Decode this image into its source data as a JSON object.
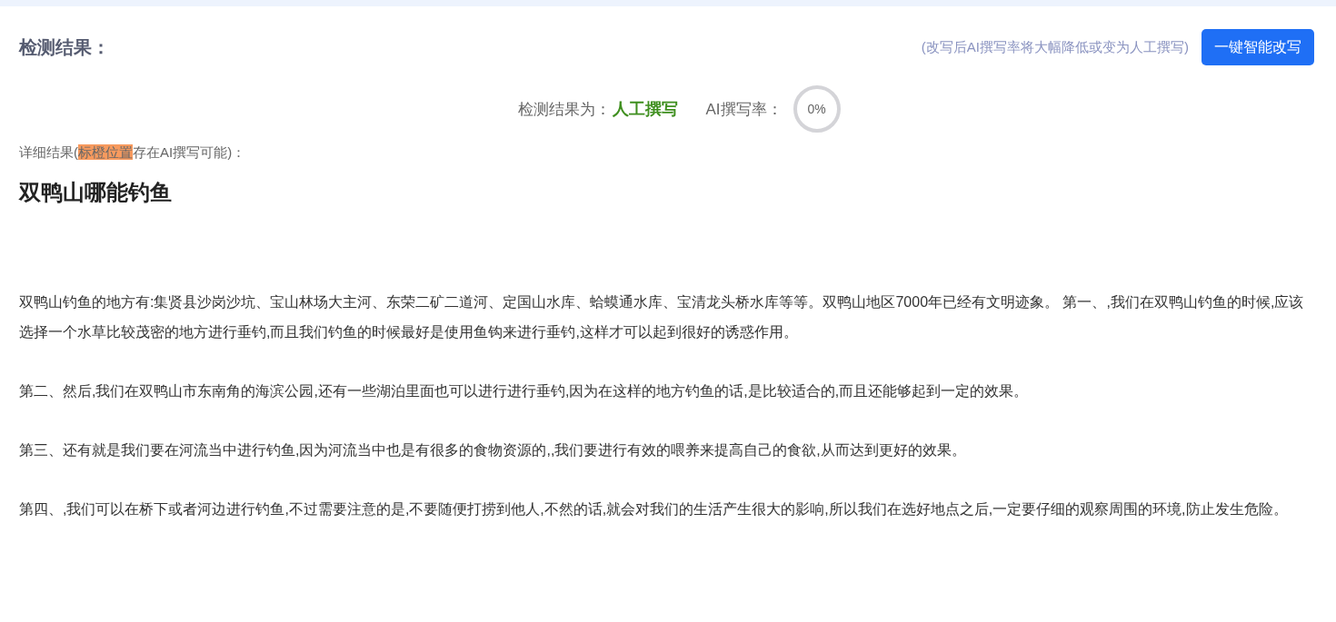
{
  "header": {
    "title": "检测结果：",
    "hint": "(改写后AI撰写率将大幅降低或变为人工撰写)",
    "rewrite_button": "一键智能改写"
  },
  "result": {
    "label": "检测结果为：",
    "verdict": {
      "text": "人工撰写",
      "kind": "human"
    },
    "rate_label": "AI撰写率：",
    "rate": {
      "text": "0%",
      "level": 0
    }
  },
  "detail": {
    "before": "详细结果(",
    "highlight": "标橙位置",
    "after": "存在AI撰写可能)："
  },
  "article": {
    "title": "双鸭山哪能钓鱼",
    "paragraphs": [
      {
        "text": "双鸭山钓鱼的地方有:集贤县沙岗沙坑、宝山林场大主河、东荣二矿二道河、定国山水库、蛤蟆通水库、宝清龙头桥水库等等。双鸭山地区7000年已经有文明迹象。 第一、,我们在双鸭山钓鱼的时候,应该选择一个水草比较茂密的地方进行垂钓,而且我们钓鱼的时候最好是使用鱼钩来进行垂钓,这样才可以起到很好的诱惑作用。"
      },
      {
        "text": "第二、然后,我们在双鸭山市东南角的海滨公园,还有一些湖泊里面也可以进行进行垂钓,因为在这样的地方钓鱼的话,是比较适合的,而且还能够起到一定的效果。"
      },
      {
        "text": "第三、还有就是我们要在河流当中进行钓鱼,因为河流当中也是有很多的食物资源的,,我们要进行有效的喂养来提高自己的食欲,从而达到更好的效果。"
      },
      {
        "text": "第四、,我们可以在桥下或者河边进行钓鱼,不过需要注意的是,不要随便打捞到他人,不然的话,就会对我们的生活产生很大的影响,所以我们在选好地点之后,一定要仔细的观察周围的环境,防止发生危险。"
      }
    ]
  }
}
